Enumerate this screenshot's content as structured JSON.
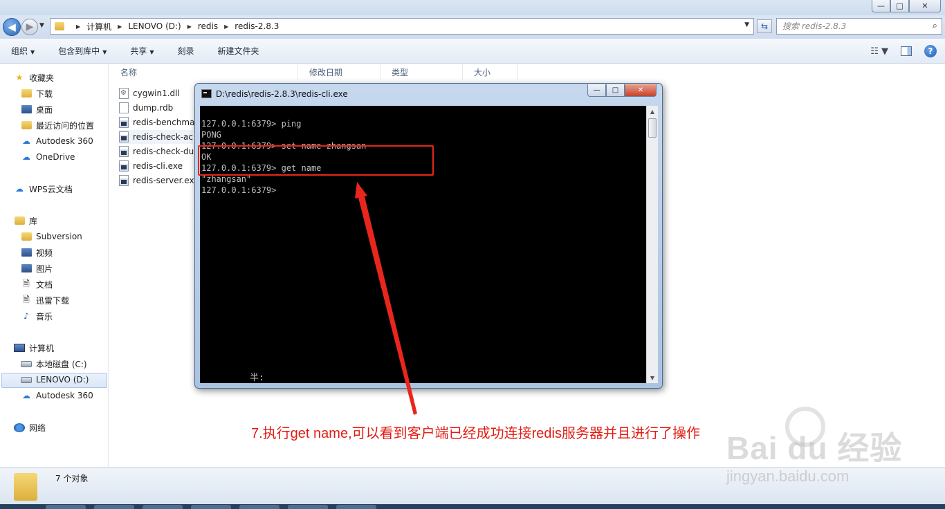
{
  "explorer": {
    "address": {
      "crumbs": [
        "计算机",
        "LENOVO (D:)",
        "redis",
        "redis-2.8.3"
      ]
    },
    "search": {
      "placeholder": "搜索 redis-2.8.3"
    },
    "toolbar": {
      "organize": "组织",
      "include_in_library": "包含到库中",
      "share": "共享",
      "burn": "刻录",
      "new_folder": "新建文件夹"
    },
    "window_controls": {
      "minimize": "—",
      "maximize": "□",
      "close": "✕"
    },
    "nav": {
      "favorites": "收藏夹",
      "downloads": "下载",
      "desktop": "桌面",
      "recent": "最近访问的位置",
      "autodesk1": "Autodesk 360",
      "onedrive": "OneDrive",
      "wps": "WPS云文档",
      "libraries": "库",
      "subversion": "Subversion",
      "videos": "视频",
      "pictures": "图片",
      "documents": "文档",
      "xunlei": "迅雷下载",
      "music": "音乐",
      "computer": "计算机",
      "local_disk": "本地磁盘 (C:)",
      "lenovo": "LENOVO (D:)",
      "autodesk2": "Autodesk 360",
      "network": "网络"
    },
    "columns": {
      "name": "名称",
      "modified": "修改日期",
      "type": "类型",
      "size": "大小"
    },
    "files": [
      "cygwin1.dll",
      "dump.rdb",
      "redis-benchma",
      "redis-check-ac",
      "redis-check-du",
      "redis-cli.exe",
      "redis-server.ex"
    ],
    "status": {
      "count": "7 个对象"
    }
  },
  "cmd": {
    "title": "D:\\redis\\redis-2.8.3\\redis-cli.exe",
    "lines": [
      "127.0.0.1:6379> ping",
      "PONG",
      "127.0.0.1:6379> set name zhangsan",
      "OK",
      "127.0.0.1:6379> get name",
      "\"zhangsan\"",
      "127.0.0.1:6379>"
    ],
    "ime": "半:",
    "buttons": {
      "minimize": "—",
      "maximize": "□",
      "close": "✕"
    }
  },
  "annotation": {
    "caption": "7.执行get name,可以看到客户端已经成功连接redis服务器并且进行了操作",
    "highlight_color": "#e8261d"
  },
  "watermark": {
    "logo": "Bai du 经验",
    "url": "jingyan.baidu.com"
  }
}
